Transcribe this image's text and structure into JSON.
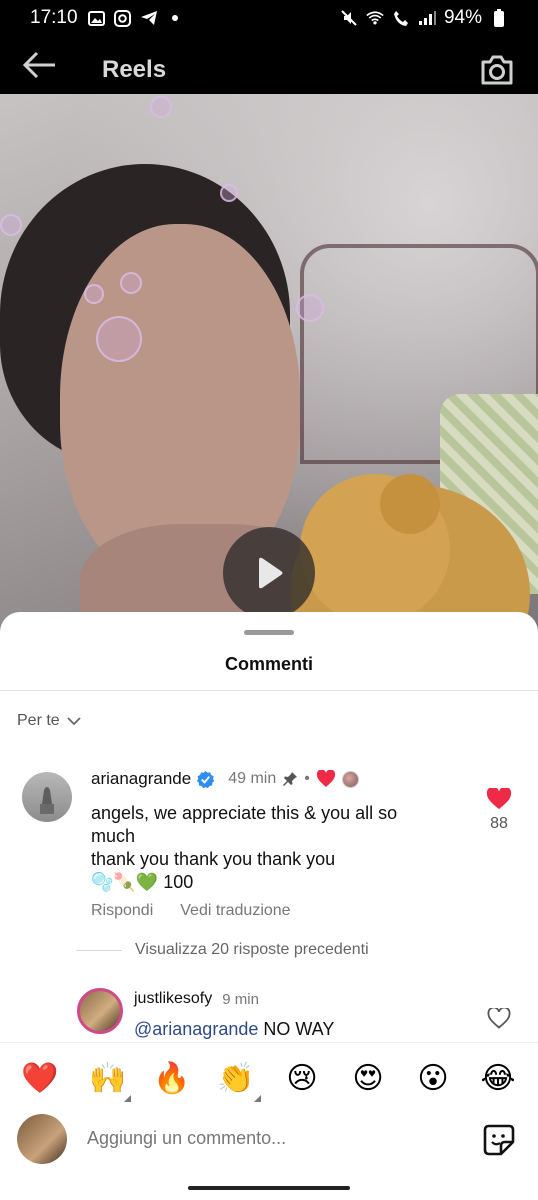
{
  "status_bar": {
    "time": "17:10",
    "battery": "94%",
    "icons": [
      "gallery-icon",
      "instagram-icon",
      "telegram-icon",
      "dot-icon",
      "mute-icon",
      "wifi-icon",
      "call-icon",
      "signal-icon",
      "battery-icon"
    ]
  },
  "header": {
    "title": "Reels",
    "back_icon": "back-arrow-icon",
    "camera_icon": "camera-icon"
  },
  "video": {
    "play_icon": "play-icon"
  },
  "comments": {
    "title": "Commenti",
    "sort_label": "Per te",
    "items": [
      {
        "username": "arianagrande",
        "verified": true,
        "time": "49 min",
        "pinned": true,
        "text_line1": "angels, we appreciate this & you all so much",
        "text_line2": "thank you thank you thank you",
        "text_line3": "🫧🍡💚 100",
        "likes": "88",
        "liked": true,
        "reply_label": "Rispondi",
        "translate_label": "Vedi traduzione"
      }
    ],
    "view_replies": "Visualizza 20 risposte precedenti",
    "reply": {
      "username": "justlikesofy",
      "time": "9 min",
      "mention": "@arianagrande",
      "text": " NO WAY"
    }
  },
  "emoji_bar": [
    "❤️",
    "🙌",
    "🔥",
    "👏",
    "😢",
    "😍",
    "😮",
    "😂"
  ],
  "input": {
    "placeholder": "Aggiungi un commento..."
  },
  "colors": {
    "like_red": "#ed2b47",
    "verified_blue": "#2f8cf0",
    "link_blue": "#2e4a86"
  }
}
